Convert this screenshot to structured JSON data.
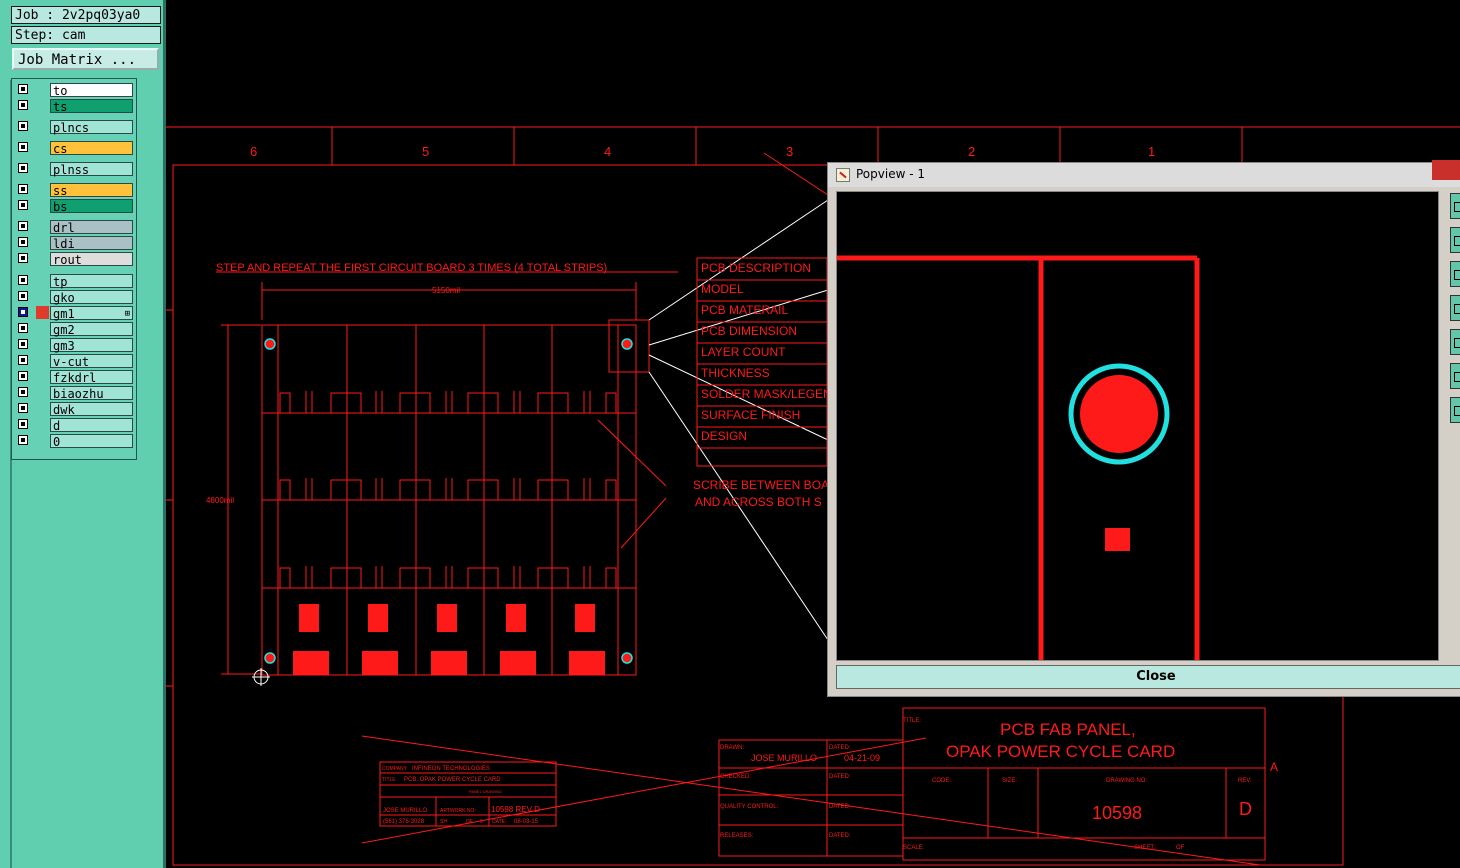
{
  "job": {
    "label": "Job : 2v2pq03ya0",
    "step": "Step: cam",
    "matrix_button": "Job Matrix ..."
  },
  "layers": [
    {
      "name": "to",
      "color": "#ffffff"
    },
    {
      "name": "ts",
      "color": "#10a070"
    },
    {
      "name": "plncs",
      "color": "#9fe4d4"
    },
    {
      "name": "cs",
      "color": "#ffc23a"
    },
    {
      "name": "plnss",
      "color": "#9fe4d4"
    },
    {
      "name": "ss",
      "color": "#ffc23a"
    },
    {
      "name": "bs",
      "color": "#10a070"
    },
    {
      "name": "drl",
      "color": "#a9c1c4"
    },
    {
      "name": "ldi",
      "color": "#a9c1c4"
    },
    {
      "name": "rout",
      "color": "#dddddd"
    },
    {
      "name": "tp",
      "color": "#9fe4d4"
    },
    {
      "name": "gko",
      "color": "#9fe4d4"
    },
    {
      "name": "gm1",
      "color": "#9fe4d4",
      "active": true
    },
    {
      "name": "gm2",
      "color": "#9fe4d4"
    },
    {
      "name": "gm3",
      "color": "#9fe4d4"
    },
    {
      "name": "v-cut",
      "color": "#9fe4d4"
    },
    {
      "name": "fzkdrl",
      "color": "#9fe4d4"
    },
    {
      "name": "biaozhu",
      "color": "#9fe4d4"
    },
    {
      "name": "dwk",
      "color": "#9fe4d4"
    },
    {
      "name": "d",
      "color": "#9fe4d4"
    },
    {
      "name": "0",
      "color": "#9fe4d4"
    }
  ],
  "drawing": {
    "columns": [
      "6",
      "5",
      "4",
      "3",
      "2",
      "1"
    ],
    "note": "STEP AND REPEAT THE FIRST CIRCUIT BOARD 3 TIMES (4 TOTAL STRIPS)",
    "dim_width": "5150mil",
    "dim_height": "4800mil",
    "table_rows": [
      "PCB DESCRIPTION",
      "MODEL",
      "PCB MATERAIL",
      "PCB DIMENSION",
      "LAYER COUNT",
      "THICKNESS",
      "SOLDER MASK/LEGEND",
      "SURFACE FINISH",
      "DESIGN"
    ],
    "scribe_1": "SCRIBE BETWEEN BOA",
    "scribe_2": "AND ACROSS BOTH S",
    "title_label": "TITLE:",
    "title_1": "PCB FAB PANEL,",
    "title_2": "OPAK POWER CYCLE CARD",
    "drawn": "DRAWN:",
    "drawn_name": "JOSE MURILLO",
    "dated": "DATED:",
    "date_1": "04-21-09",
    "checked": "CHECKED:",
    "quality": "QUALITY CONTROL:",
    "releases": "RELEASES:",
    "code": "CODE:",
    "size": "SIZE:",
    "drawing_no_label": "DRAWING NO:",
    "drawing_no": "10598",
    "rev_label": "REV:",
    "rev": "D",
    "scale": "SCALE:",
    "sheet": "SHEET:",
    "of": "OF",
    "corner": "A",
    "small_company_label": "COMPANY",
    "small_company": "INFINEON TECHNOLOGIES",
    "small_title_label": "TITLE",
    "small_title": "PCB, OPAK POWER CYCLE CARD",
    "small_sub": "PANEL DRAWING",
    "small_name": "JOSE MURILLO",
    "small_artwork": "ARTWORK NO:",
    "small_artno": "10598 REV D",
    "small_phone": "(561) 376-3028",
    "small_sh": "SH",
    "small_of": "OF",
    "small_6": "6",
    "small_date_label": "DATE:",
    "small_date": "08-03-15"
  },
  "popview": {
    "title": "Popview - 1",
    "close": "Close"
  }
}
